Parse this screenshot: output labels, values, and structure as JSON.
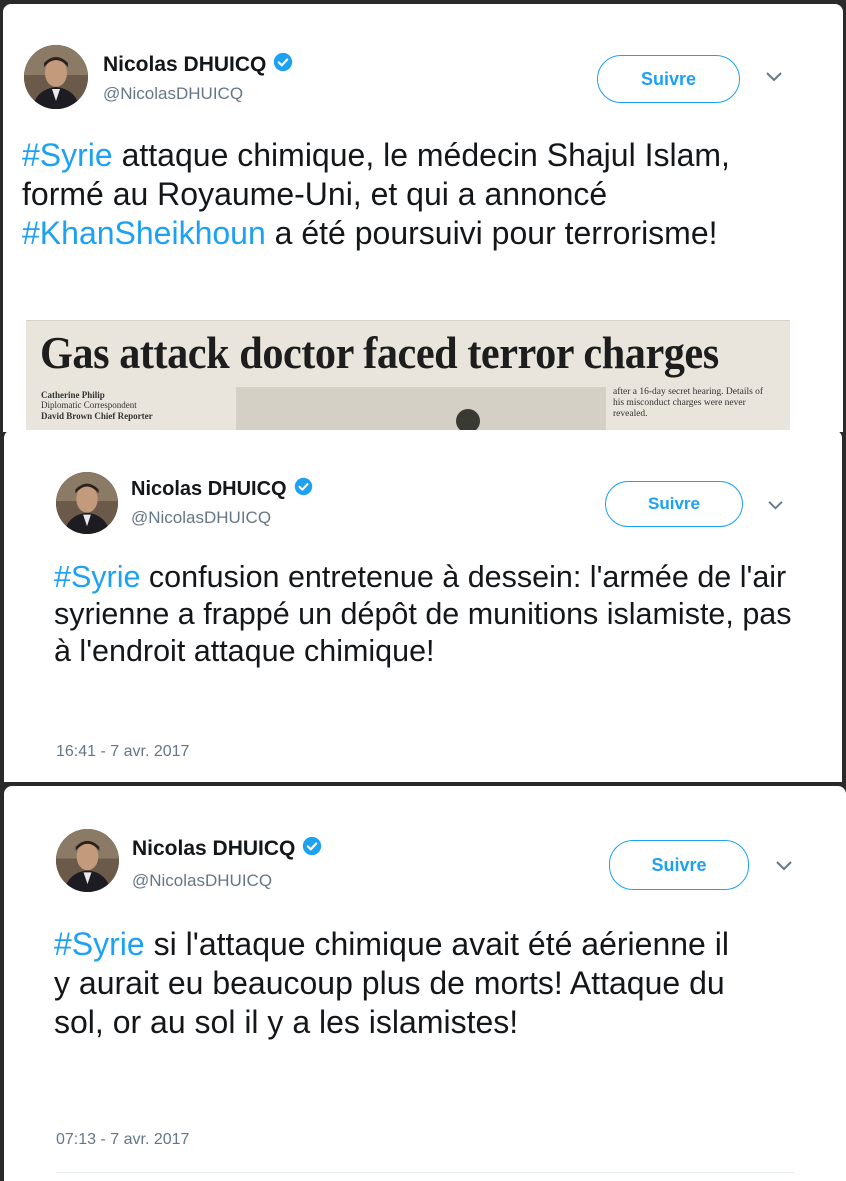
{
  "colors": {
    "accent": "#1da1f2",
    "secondary": "#657786",
    "text": "#14171a"
  },
  "tweets": [
    {
      "name": "Nicolas DHUICQ",
      "handle": "@NicolasDHUICQ",
      "follow_label": "Suivre",
      "text_parts": [
        {
          "t": "#Syrie",
          "h": true
        },
        {
          "t": " attaque chimique, le médecin Shajul Islam, formé au Royaume-Uni, et qui a annoncé ",
          "h": false
        },
        {
          "t": "#KhanSheikhoun",
          "h": true
        },
        {
          "t": " a été poursuivi pour terrorisme!",
          "h": false
        }
      ],
      "media": {
        "headline": "Gas attack doctor faced terror charges",
        "byline": [
          "Catherine Philip",
          "Diplomatic Correspondent",
          "David Brown Chief Reporter"
        ],
        "column": [
          "after a 16-day secret hearing. Details of",
          "his misconduct charges were never",
          "revealed."
        ]
      }
    },
    {
      "name": "Nicolas DHUICQ",
      "handle": "@NicolasDHUICQ",
      "follow_label": "Suivre",
      "text_parts": [
        {
          "t": "#Syrie",
          "h": true
        },
        {
          "t": " confusion entretenue à dessein: l'armée de l'air syrienne a frappé un dépôt de munitions islamiste, pas à l'endroit attaque chimique!",
          "h": false
        }
      ],
      "timestamp": "16:41 - 7 avr. 2017"
    },
    {
      "name": "Nicolas DHUICQ",
      "handle": "@NicolasDHUICQ",
      "follow_label": "Suivre",
      "text_parts": [
        {
          "t": "#Syrie",
          "h": true
        },
        {
          "t": " si l'attaque chimique avait été aérienne il y aurait eu beaucoup plus de morts! Attaque du sol, or au sol il y a les islamistes!",
          "h": false
        }
      ],
      "timestamp": "07:13 - 7 avr. 2017"
    }
  ]
}
